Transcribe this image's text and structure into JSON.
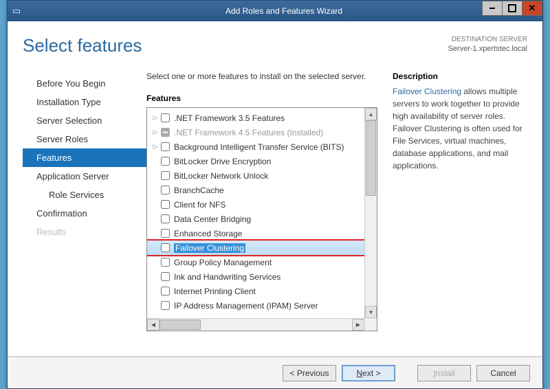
{
  "window": {
    "title": "Add Roles and Features Wizard"
  },
  "heading": "Select features",
  "destination": {
    "label": "DESTINATION SERVER",
    "server": "Server-1.xpertstec.local"
  },
  "nav": [
    {
      "label": "Before You Begin"
    },
    {
      "label": "Installation Type"
    },
    {
      "label": "Server Selection"
    },
    {
      "label": "Server Roles"
    },
    {
      "label": "Features",
      "active": true
    },
    {
      "label": "Application Server"
    },
    {
      "label": "Role Services",
      "indent": true
    },
    {
      "label": "Confirmation"
    },
    {
      "label": "Results",
      "disabled": true
    }
  ],
  "instruction": "Select one or more features to install on the selected server.",
  "features_label": "Features",
  "description_label": "Description",
  "description_link": "Failover Clustering",
  "description_text": " allows multiple servers to work together to provide high availability of server roles. Failover Clustering is often used for File Services, virtual machines, database applications, and mail applications.",
  "features": [
    {
      "label": ".NET Framework 3.5 Features",
      "expandable": true
    },
    {
      "label": ".NET Framework 4.5 Features (Installed)",
      "expandable": true,
      "installed": true
    },
    {
      "label": "Background Intelligent Transfer Service (BITS)",
      "expandable": true
    },
    {
      "label": "BitLocker Drive Encryption"
    },
    {
      "label": "BitLocker Network Unlock"
    },
    {
      "label": "BranchCache"
    },
    {
      "label": "Client for NFS"
    },
    {
      "label": "Data Center Bridging"
    },
    {
      "label": "Enhanced Storage"
    },
    {
      "label": "Failover Clustering",
      "highlight": true
    },
    {
      "label": "Group Policy Management"
    },
    {
      "label": "Ink and Handwriting Services"
    },
    {
      "label": "Internet Printing Client"
    },
    {
      "label": "IP Address Management (IPAM) Server"
    }
  ],
  "buttons": {
    "prev": "< Previous",
    "next": "Next >",
    "install": "Install",
    "cancel": "Cancel"
  }
}
